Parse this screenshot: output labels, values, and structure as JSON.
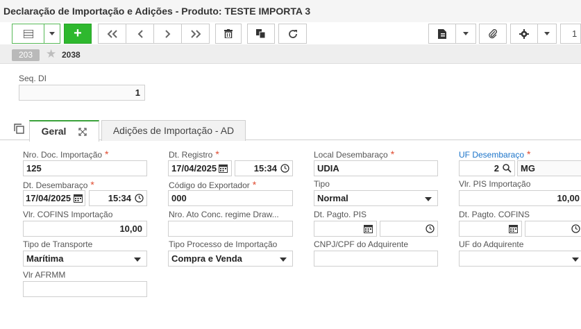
{
  "window": {
    "title": "Declaração de Importação e Adições - Produto: TESTE IMPORTA 3"
  },
  "toolbar": {
    "add_label": "+",
    "page_number": "1"
  },
  "record": {
    "badge": "203",
    "number": "2038"
  },
  "seq_di": {
    "label": "Seq. DI",
    "value": "1"
  },
  "tabs": [
    {
      "label": "Geral"
    },
    {
      "label": "Adições de Importação - AD"
    }
  ],
  "form": {
    "nro_doc": {
      "label": "Nro. Doc. Importação",
      "value": "125"
    },
    "dt_registro": {
      "label": "Dt. Registro",
      "date": "17/04/2025",
      "time": "15:34"
    },
    "local_desembaraco": {
      "label": "Local Desembaraço",
      "value": "UDIA"
    },
    "uf_desembaraco": {
      "label": "UF Desembaraço",
      "code": "2",
      "uf": "MG"
    },
    "dt_desembaraco": {
      "label": "Dt. Desembaraço",
      "date": "17/04/2025",
      "time": "15:34"
    },
    "codigo_exportador": {
      "label": "Código do Exportador",
      "value": "000"
    },
    "tipo": {
      "label": "Tipo",
      "value": "Normal"
    },
    "vlr_pis": {
      "label": "Vlr. PIS Importação",
      "value": "10,00"
    },
    "vlr_cofins": {
      "label": "Vlr. COFINS Importação",
      "value": "10,00"
    },
    "nro_ato": {
      "label": "Nro. Ato Conc. regime Draw...",
      "value": ""
    },
    "dt_pagto_pis": {
      "label": "Dt. Pagto. PIS",
      "date": "",
      "time": ""
    },
    "dt_pagto_cofins": {
      "label": "Dt. Pagto. COFINS",
      "date": "",
      "time": ""
    },
    "tipo_transporte": {
      "label": "Tipo de Transporte",
      "value": "Marítima"
    },
    "tipo_processo": {
      "label": "Tipo Processo de Importação",
      "value": "Compra e Venda"
    },
    "cnpj_adquirente": {
      "label": "CNPJ/CPF do Adquirente",
      "value": ""
    },
    "uf_adquirente": {
      "label": "UF do Adquirente",
      "value": ""
    },
    "vlr_afrmm": {
      "label": "Vlr AFRMM",
      "value": ""
    }
  },
  "colors": {
    "accent_green": "#2eb82e",
    "required_star": "#e04a2f",
    "link_blue": "#1a73c9"
  }
}
